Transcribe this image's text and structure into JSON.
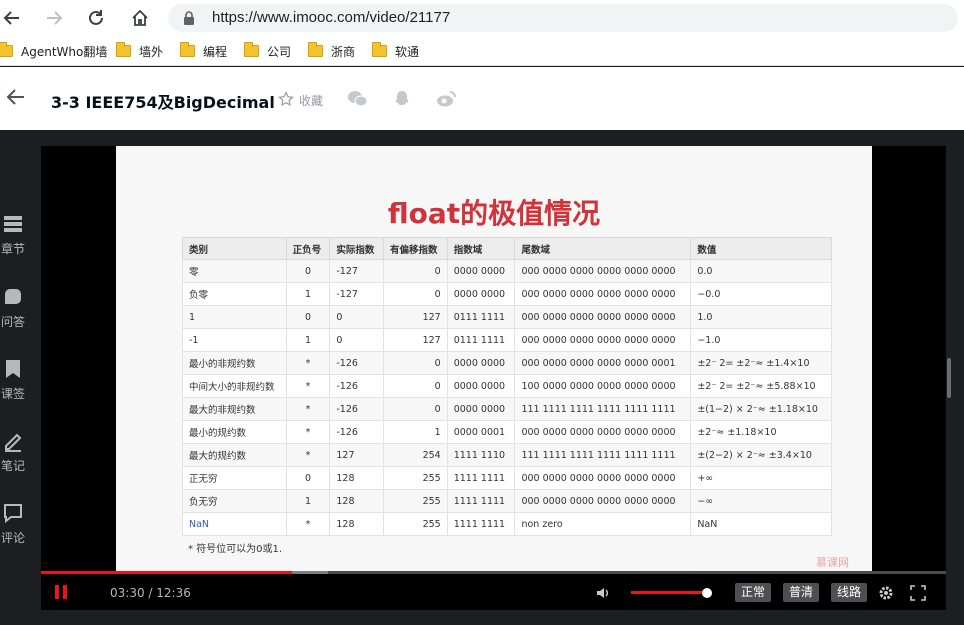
{
  "browser": {
    "url": "https://www.imooc.com/video/21177",
    "bookmarks": [
      "AgentWho翻墙",
      "墙外",
      "编程",
      "公司",
      "浙商",
      "软通"
    ]
  },
  "header": {
    "title": "3-3 IEEE754及BigDecimal",
    "favorite_label": "收藏"
  },
  "sidebar": {
    "items": [
      {
        "label": "章节",
        "icon": "chapters-icon"
      },
      {
        "label": "问答",
        "icon": "qa-icon"
      },
      {
        "label": "课签",
        "icon": "bookmark-icon"
      },
      {
        "label": "笔记",
        "icon": "pencil-icon"
      },
      {
        "label": "评论",
        "icon": "comment-icon"
      }
    ]
  },
  "slide": {
    "title": "float的极值情况",
    "headers": [
      "类别",
      "正负号",
      "实际指数",
      "有偏移指数",
      "指数域",
      "尾数域",
      "数值"
    ],
    "rows": [
      [
        "零",
        "0",
        "-127",
        "0",
        "0000 0000",
        "000 0000 0000 0000 0000 0000",
        "0.0"
      ],
      [
        "负零",
        "1",
        "-127",
        "0",
        "0000 0000",
        "000 0000 0000 0000 0000 0000",
        "−0.0"
      ],
      [
        "1",
        "0",
        "0",
        "127",
        "0111 1111",
        "000 0000 0000 0000 0000 0000",
        "1.0"
      ],
      [
        "-1",
        "1",
        "0",
        "127",
        "0111 1111",
        "000 0000 0000 0000 0000 0000",
        "−1.0"
      ],
      [
        "最小的非规约数",
        "*",
        "-126",
        "0",
        "0000 0000",
        "000 0000 0000 0000 0000 0001",
        "±2⁻ 2= ±2⁻≈ ±1.4×10"
      ],
      [
        "中间大小的非规约数",
        "*",
        "-126",
        "0",
        "0000 0000",
        "100 0000 0000 0000 0000 0000",
        "±2⁻ 2= ±2⁻≈ ±5.88×10"
      ],
      [
        "最大的非规约数",
        "*",
        "-126",
        "0",
        "0000 0000",
        "111 1111 1111 1111 1111 1111",
        "±(1−2) × 2⁻≈ ±1.18×10"
      ],
      [
        "最小的规约数",
        "*",
        "-126",
        "1",
        "0000 0001",
        "000 0000 0000 0000 0000 0000",
        "±2⁻≈ ±1.18×10"
      ],
      [
        "最大的规约数",
        "*",
        "127",
        "254",
        "1111 1110",
        "111 1111 1111 1111 1111 1111",
        "±(2−2) × 2⁻≈ ±3.4×10"
      ],
      [
        "正无穷",
        "0",
        "128",
        "255",
        "1111 1111",
        "000 0000 0000 0000 0000 0000",
        "+∞"
      ],
      [
        "负无穷",
        "1",
        "128",
        "255",
        "1111 1111",
        "000 0000 0000 0000 0000 0000",
        "−∞"
      ],
      [
        "NaN",
        "*",
        "128",
        "255",
        "1111 1111",
        "non zero",
        "NaN"
      ]
    ],
    "note": "* 符号位可以为0或1.",
    "watermark": "慕课网"
  },
  "player": {
    "time": "03:30 / 12:36",
    "progress": 0.277,
    "buffered": 0.317,
    "volume": 0.95,
    "quality_buttons": [
      "正常",
      "普清",
      "线路"
    ]
  },
  "colors": {
    "accent": "#f01414",
    "title_red": "#d2323a",
    "nan_blue": "#2a5db0"
  }
}
